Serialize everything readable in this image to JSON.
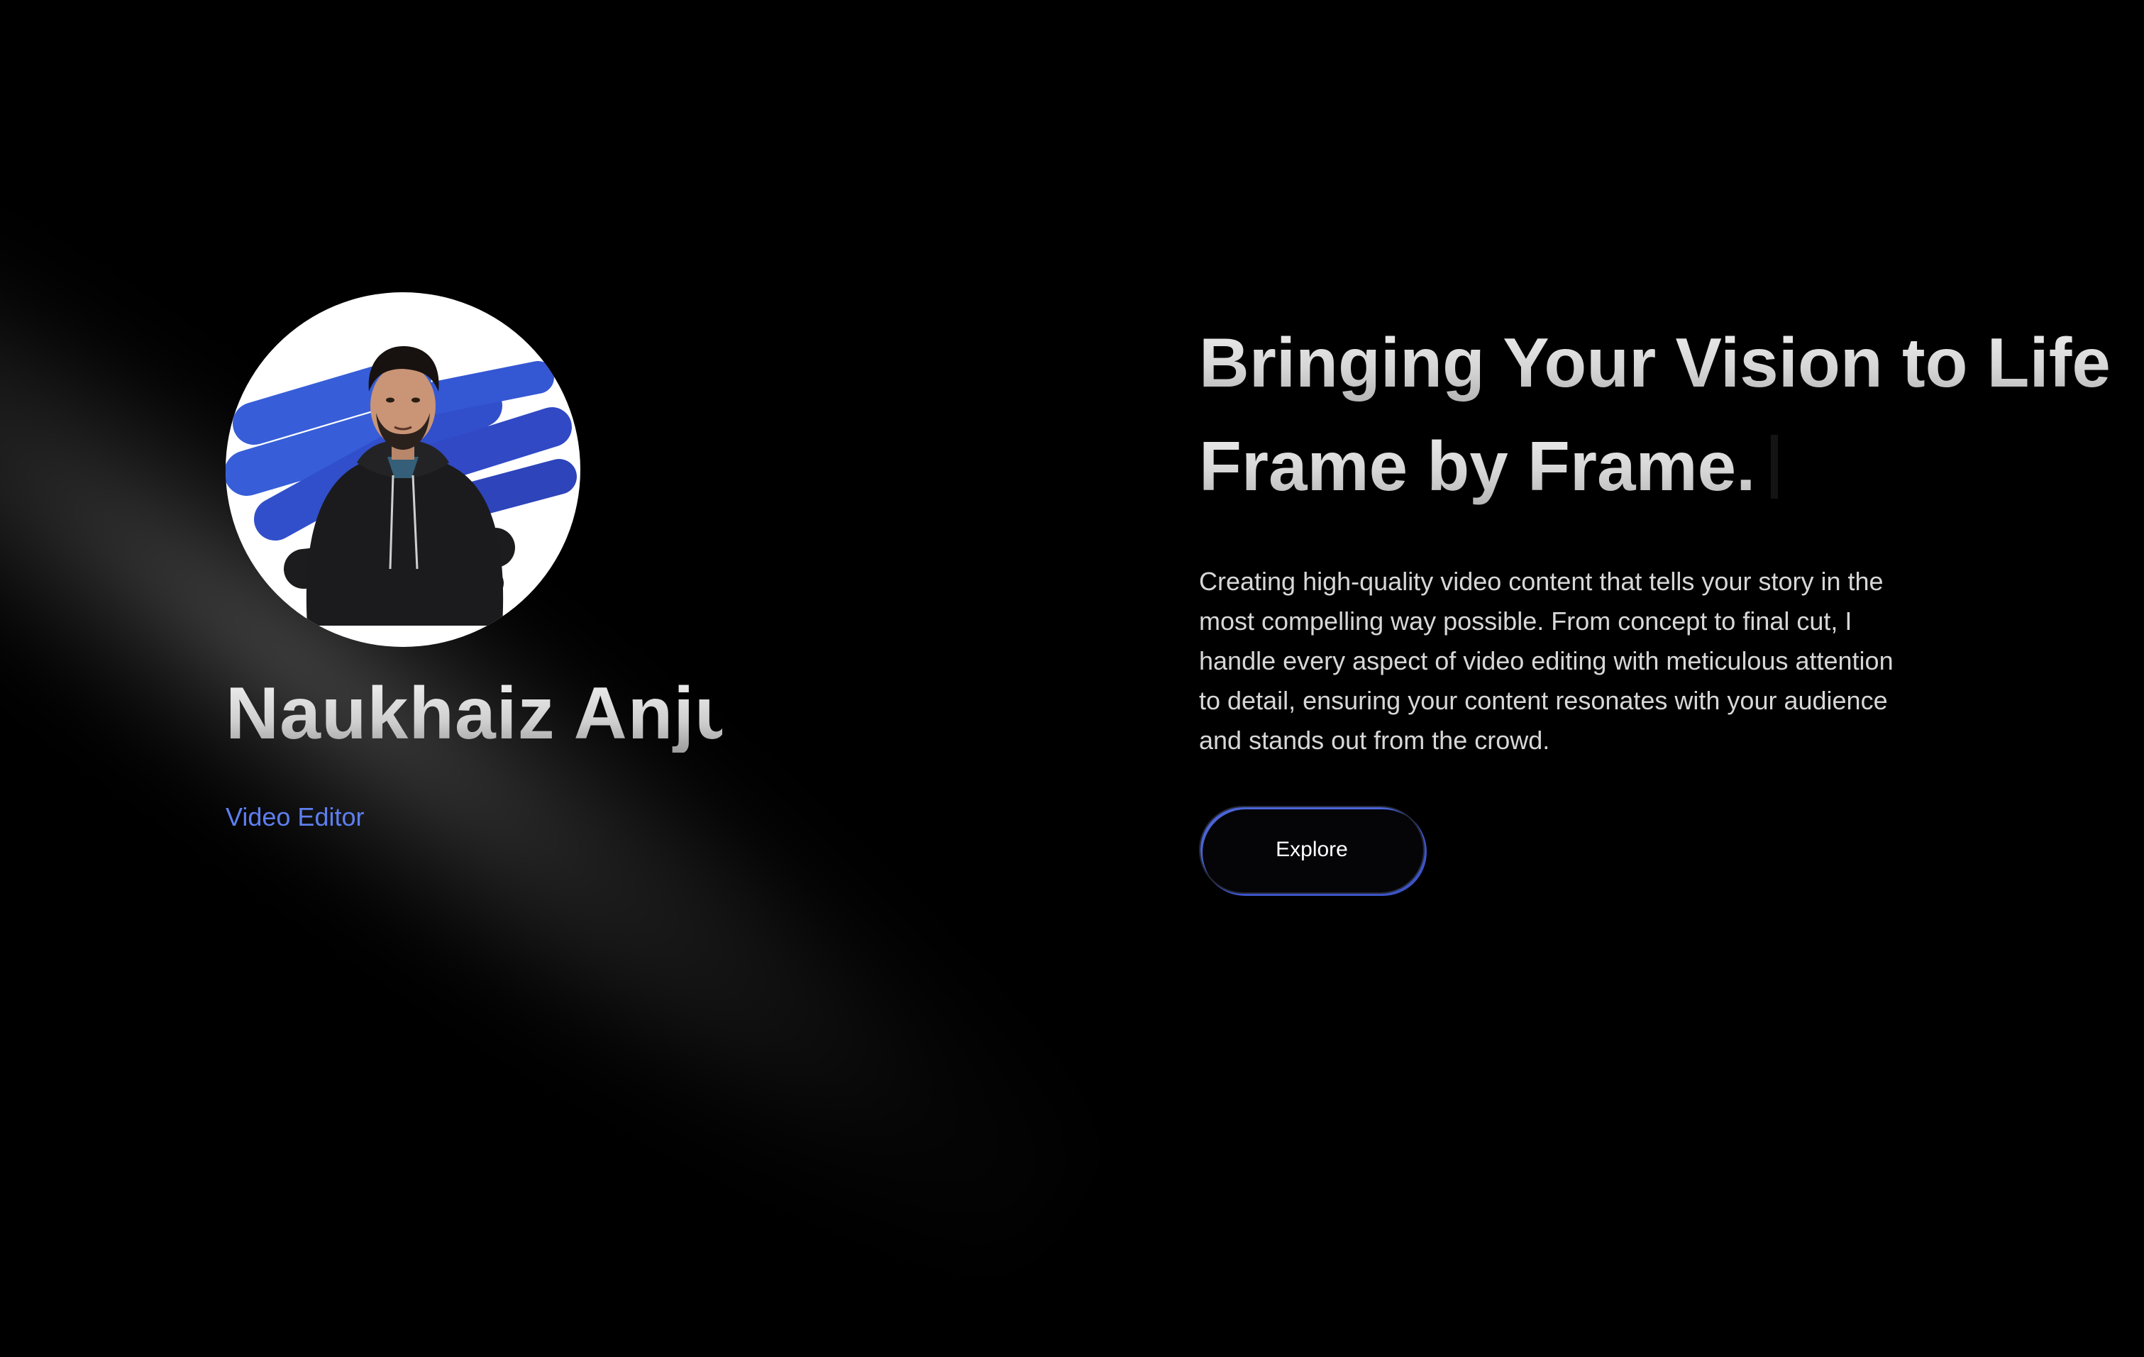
{
  "profile": {
    "name": "Naukhaiz Anjum",
    "role": "Video Editor"
  },
  "hero": {
    "headline_line1": "Bringing Your Vision to Life.",
    "headline_line2": "Frame by Frame.",
    "description": "Creating high-quality video content that tells your story in the most compelling way possible. From concept to final cut, I handle every aspect of video editing with meticulous attention to detail, ensuring your content resonates with your audience and stands out from the crowd.",
    "cta_label": "Explore"
  },
  "colors": {
    "background": "#000000",
    "accent": "#5e7ff0",
    "brush_blue": "#2d56d6"
  }
}
